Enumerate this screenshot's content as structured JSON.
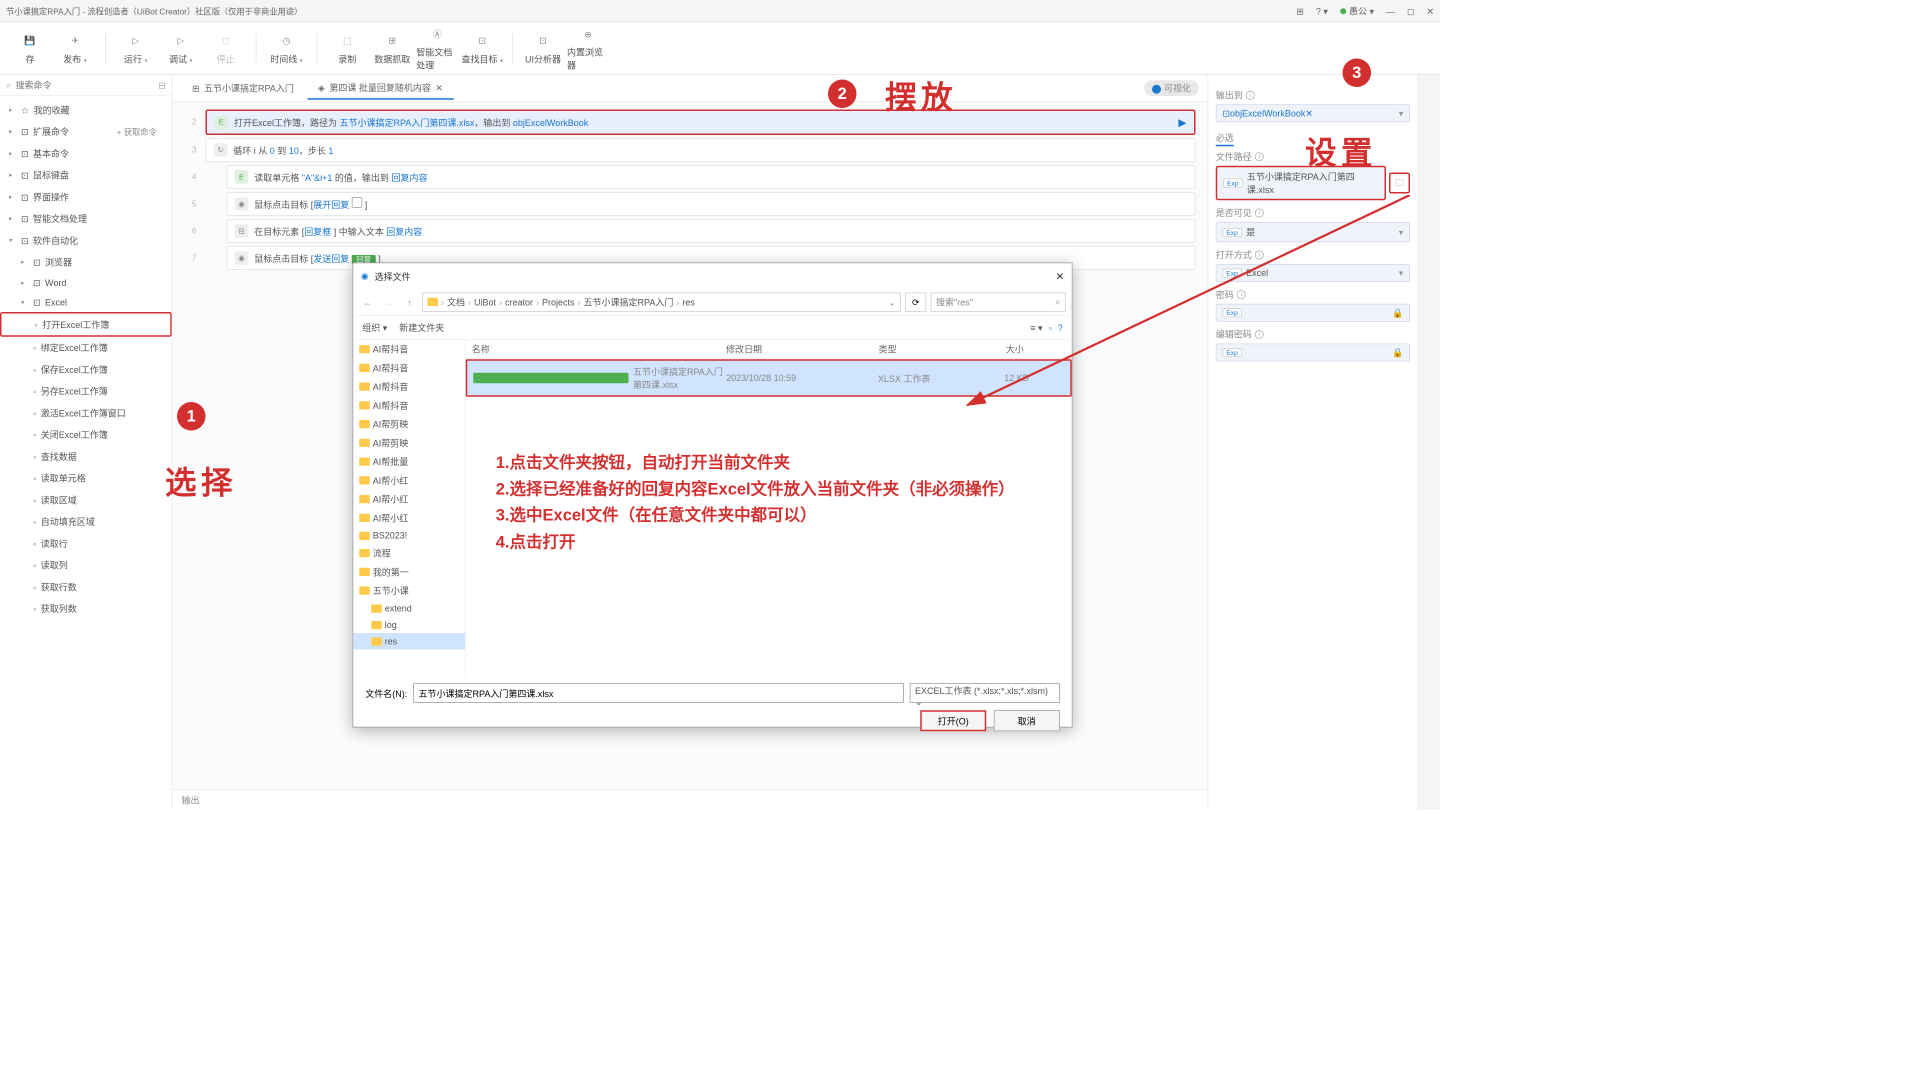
{
  "titlebar": {
    "text": "节小课搞定RPA入门 - 流程创造者（UiBot Creator）社区版（仅用于非商业用途）",
    "user": "愚公"
  },
  "toolbar": {
    "save": "存",
    "publish": "发布",
    "run": "运行",
    "debug": "调试",
    "stop": "停止",
    "timeline": "时间线",
    "record": "录制",
    "datacapture": "数据抓取",
    "docai": "智能文档处理",
    "findtarget": "查找目标",
    "uianalyzer": "UI分析器",
    "browser": "内置浏览器"
  },
  "leftSearch": {
    "placeholder": "搜索命令"
  },
  "leftTree": {
    "favorites": "我的收藏",
    "extcmd": "扩展命令",
    "getcmd": "+ 获取命令",
    "basiccmd": "基本命令",
    "mousekb": "鼠标键盘",
    "ui": "界面操作",
    "docai": "智能文档处理",
    "automation": "软件自动化",
    "browser": "浏览器",
    "word": "Word",
    "excel": "Excel",
    "excel_open": "打开Excel工作簿",
    "excel_bind": "绑定Excel工作簿",
    "excel_save": "保存Excel工作簿",
    "excel_saveas": "另存Excel工作簿",
    "excel_activate": "激活Excel工作簿窗口",
    "excel_close": "关闭Excel工作簿",
    "excel_find": "查找数据",
    "excel_readcell": "读取单元格",
    "excel_readrange": "读取区域",
    "excel_fillrange": "自动填充区域",
    "excel_readrow": "读取行",
    "excel_readcol": "读取列",
    "excel_rowcount": "获取行数",
    "excel_colcount": "获取列数"
  },
  "tabs": {
    "tab1": "五节小课搞定RPA入门",
    "tab2": "第四课 批量回复随机内容",
    "visualize": "可视化"
  },
  "code": {
    "l2_a": "打开Excel工作簿，路径为",
    "l2_link": "五节小课搞定RPA入门第四课.xlsx",
    "l2_b": "，输出到",
    "l2_out": "objExcelWorkBook",
    "l3_a": "循环 i 从",
    "l3_from": "0",
    "l3_to": "到",
    "l3_toval": "10",
    "l3_step": "，步长",
    "l3_stepval": "1",
    "l4_a": "读取单元格",
    "l4_cell": "\"A\"&i+1",
    "l4_b": "的值，输出到",
    "l4_out": "回复内容",
    "l5_a": "鼠标点击目标 [",
    "l5_t": "展开回复",
    "l5_b": "]",
    "l6_a": "在目标元素 [",
    "l6_t": "回复框",
    "l6_b": "] 中输入文本",
    "l6_out": "回复内容",
    "l7_a": "鼠标点击目标 [",
    "l7_t": "发送回复",
    "l7_b": "]"
  },
  "bottom": {
    "output": "输出"
  },
  "right": {
    "output_to": "输出到",
    "output_var": "objExcelWorkBook",
    "required": "必选",
    "filepath": "文件路径",
    "filepath_val": "五节小课搞定RPA入门第四课.xlsx",
    "visible": "是否可见",
    "visible_val": "是",
    "openmode": "打开方式",
    "openmode_val": "Excel",
    "password": "密码",
    "editpassword": "编辑密码"
  },
  "dialog": {
    "title": "选择文件",
    "breadcrumb": [
      "文档",
      "UiBot",
      "creator",
      "Projects",
      "五节小课搞定RPA入门",
      "res"
    ],
    "search_placeholder": "搜索\"res\"",
    "organize": "组织",
    "newfolder": "新建文件夹",
    "treeItems": [
      "AI帮抖音",
      "AI帮抖音",
      "AI帮抖音",
      "AI帮抖音",
      "AI帮剪映",
      "AI帮剪映",
      "AI帮批量",
      "AI帮小红",
      "AI帮小红",
      "AI帮小红",
      "BS2023!",
      "流程",
      "我的第一",
      "五节小课",
      "extend",
      "log",
      "res"
    ],
    "headers": {
      "name": "名称",
      "date": "修改日期",
      "type": "类型",
      "size": "大小"
    },
    "file": {
      "name": "五节小课搞定RPA入门第四课.xlsx",
      "date": "2023/10/28 10:59",
      "type": "XLSX 工作表",
      "size": "12 KB"
    },
    "filename_label": "文件名(N):",
    "filename_val": "五节小课搞定RPA入门第四课.xlsx",
    "filter": "EXCEL工作表 (*.xlsx;*.xls;*.xlsm)",
    "open": "打开(O)",
    "cancel": "取消"
  },
  "anno": {
    "place": "摆放",
    "select": "选择",
    "settings": "设置",
    "instr": "1.点击文件夹按钮，自动打开当前文件夹\n2.选择已经准备好的回复内容Excel文件放入当前文件夹（非必须操作）\n3.选中Excel文件（在任意文件夹中都可以）\n4.点击打开"
  }
}
